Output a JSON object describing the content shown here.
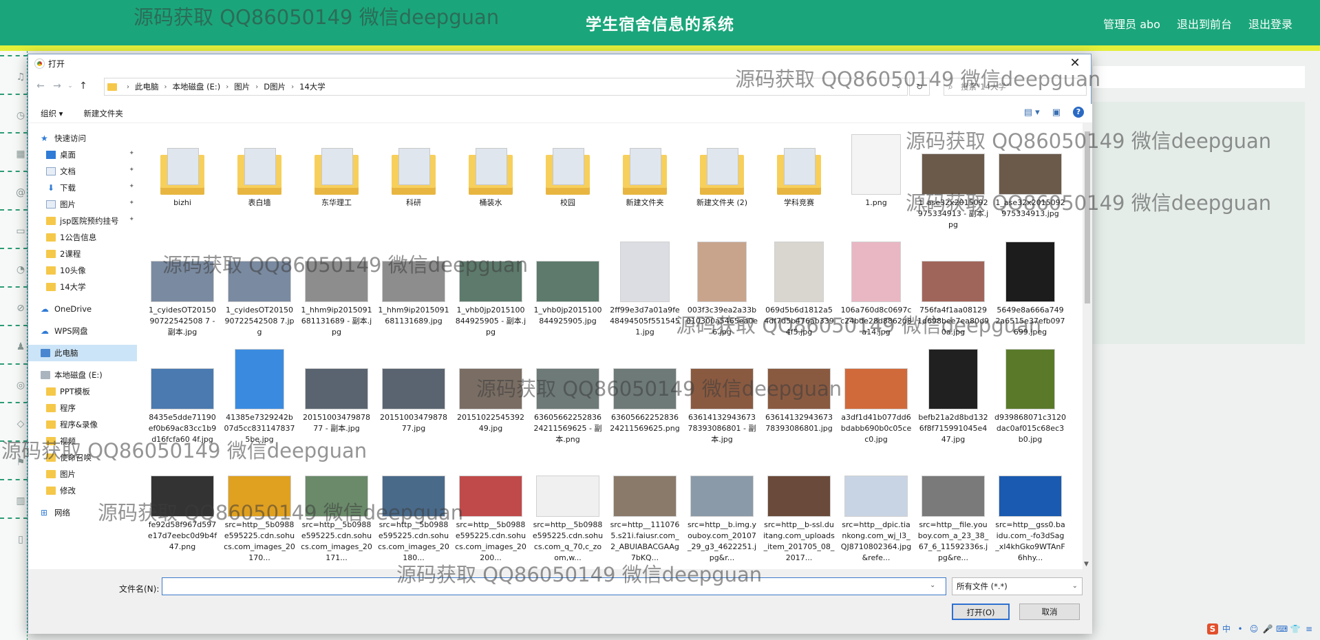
{
  "app": {
    "title": "学生宿舍信息的系统",
    "links": [
      "管理员 abo",
      "退出到前台",
      "退出登录"
    ]
  },
  "watermark_text": "源码获取 QQ86050149 微信deepguan",
  "dialog": {
    "title": "打开",
    "close": "✕",
    "breadcrumbs": [
      "此电脑",
      "本地磁盘 (E:)",
      "图片",
      "D图片",
      "14大学"
    ],
    "search_placeholder": "搜索\"14大学\"",
    "toolbar": {
      "organize": "组织 ▾",
      "new_folder": "新建文件夹"
    },
    "nav": {
      "quick_access": "快速访问",
      "desktop": "桌面",
      "documents": "文档",
      "downloads": "下载",
      "pictures": "图片",
      "folder_jsp": "jsp医院预约挂号",
      "folder_notice": "1公告信息",
      "folder_course": "2课程",
      "folder_avatar": "10头像",
      "folder_univ": "14大学",
      "onedrive": "OneDrive",
      "wps": "WPS网盘",
      "this_pc": "此电脑",
      "local_disk": "本地磁盘 (E:)",
      "ppt": "PPT模板",
      "program": "程序",
      "program_rec": "程序&录像",
      "video": "视频",
      "summon": "使命召唤",
      "pictures2": "图片",
      "edit": "修改",
      "network": "网络"
    },
    "files": [
      {
        "name": "bizhi",
        "kind": "folder"
      },
      {
        "name": "表白墙",
        "kind": "folder"
      },
      {
        "name": "东华理工",
        "kind": "folder"
      },
      {
        "name": "科研",
        "kind": "folder"
      },
      {
        "name": "桶装水",
        "kind": "folder"
      },
      {
        "name": "校园",
        "kind": "folder"
      },
      {
        "name": "新建文件夹",
        "kind": "folder"
      },
      {
        "name": "新建文件夹 (2)",
        "kind": "folder"
      },
      {
        "name": "学科竞赛",
        "kind": "folder"
      },
      {
        "name": "1.png",
        "kind": "tall",
        "color": "#f4f4f4"
      },
      {
        "name": "1_ase32x2015092975334913 - 副本.jpg",
        "kind": "img",
        "color": "#6b5a4a"
      },
      {
        "name": "1_ase32x2015092975334913.jpg",
        "kind": "img",
        "color": "#6b5a4a"
      },
      {
        "name": "1_cyidesOT2015090722542508 7 - 副本.jpg",
        "kind": "img",
        "color": "#7a8aa0"
      },
      {
        "name": "1_cyidesOT2015090722542508 7.jpg",
        "kind": "img",
        "color": "#7a8aa0"
      },
      {
        "name": "1_hhm9ip2015091681131689 - 副本.jpg",
        "kind": "img",
        "color": "#8d8d8d"
      },
      {
        "name": "1_hhm9ip2015091681131689.jpg",
        "kind": "img",
        "color": "#8d8d8d"
      },
      {
        "name": "1_vhb0jp2015100844925905 - 副本.jpg",
        "kind": "img",
        "color": "#5d7a6c"
      },
      {
        "name": "1_vhb0jp2015100844925905.jpg",
        "kind": "img",
        "color": "#5d7a6c"
      },
      {
        "name": "2ff99e3d7a01a9fe48494505f5515451.jpg",
        "kind": "tall",
        "color": "#dcdde2"
      },
      {
        "name": "003f3c39ea2a33b010300a5465ea0e6.jpg",
        "kind": "tall",
        "color": "#c8a48d"
      },
      {
        "name": "069d5b6d1812a54df7d5b476ab3394f5.jpg",
        "kind": "tall",
        "color": "#d8d6cf"
      },
      {
        "name": "106a760d8c0697cc24bde28d8862d8a14.jpg",
        "kind": "tall",
        "color": "#e9b7c3"
      },
      {
        "name": "756fa4f1aa081291d698bee7ea80d90a.jpg",
        "kind": "img",
        "color": "#a0655a"
      },
      {
        "name": "5649e8a666a7492a6515e37efb097699.jpeg",
        "kind": "tall",
        "color": "#1c1c1c"
      },
      {
        "name": "8435e5dde71190ef0b69ac83cc1b9d16fcfa60 4f.jpg",
        "kind": "img",
        "color": "#4a7ab0"
      },
      {
        "name": "41385e7329242b07d5cc8311478375be.jpg",
        "kind": "tall",
        "color": "#3a8be0"
      },
      {
        "name": "2015100347987877 - 副本.jpg",
        "kind": "img",
        "color": "#5a6470"
      },
      {
        "name": "2015100347987877.jpg",
        "kind": "img",
        "color": "#5a6470"
      },
      {
        "name": "2015102254539249.jpg",
        "kind": "img",
        "color": "#7a6e64"
      },
      {
        "name": "6360566225283624211569625 - 副本.png",
        "kind": "img",
        "color": "#6e7a78"
      },
      {
        "name": "6360566225283624211569625.png",
        "kind": "img",
        "color": "#6e7a78"
      },
      {
        "name": "6361413294367378393086801 - 副本.jpg",
        "kind": "img",
        "color": "#8a5a40"
      },
      {
        "name": "6361413294367378393086801.jpg",
        "kind": "img",
        "color": "#8a5a40"
      },
      {
        "name": "a3df1d41b077dd6bdabb690b0c05cec0.jpg",
        "kind": "img",
        "color": "#d06a3a"
      },
      {
        "name": "befb21a2d8bd1326f8f715991045e447.jpg",
        "kind": "tall",
        "color": "#202020"
      },
      {
        "name": "d939868071c3120dac0af015c68ec3b0.jpg",
        "kind": "tall",
        "color": "#5a7a2a"
      },
      {
        "name": "fe92d58f967d597e17d7eebc0d9b4f47.png",
        "kind": "img",
        "color": "#333333"
      },
      {
        "name": "src=http__5b0988e595225.cdn.sohucs.com_images_20170...",
        "kind": "img",
        "color": "#e0a020"
      },
      {
        "name": "src=http__5b0988e595225.cdn.sohucs.com_images_20171...",
        "kind": "img",
        "color": "#6a8a6a"
      },
      {
        "name": "src=http__5b0988e595225.cdn.sohucs.com_images_20180...",
        "kind": "img",
        "color": "#4a6a8a"
      },
      {
        "name": "src=http__5b0988e595225.cdn.sohucs.com_images_20200...",
        "kind": "img",
        "color": "#c04a4a"
      },
      {
        "name": "src=http__5b0988e595225.cdn.sohucs.com_q_70,c_zoom,w...",
        "kind": "img",
        "color": "#f0f0f0"
      },
      {
        "name": "src=http__1110765.s21i.faiusr.com_2_ABUIABACGAAg7bKQ...",
        "kind": "img",
        "color": "#8a7a6a"
      },
      {
        "name": "src=http__b.img.youboy.com_20107_29_g3_4622251.jpg&r...",
        "kind": "img",
        "color": "#8a9aa8"
      },
      {
        "name": "src=http__b-ssl.duitang.com_uploads_item_201705_08_2017...",
        "kind": "img",
        "color": "#6a4a3a"
      },
      {
        "name": "src=http__dpic.tiankong.com_wj_l3_QJ8710802364.jpg&refe...",
        "kind": "img",
        "color": "#c8d4e4"
      },
      {
        "name": "src=http__file.youboy.com_a_23_38_67_6_11592336s.jpg&re...",
        "kind": "img",
        "color": "#7a7a7a"
      },
      {
        "name": "src=http__gss0.baidu.com_-fo3dSag_xI4khGko9WTAnF6hhy...",
        "kind": "img",
        "color": "#1a5ab0"
      }
    ],
    "filename_label": "文件名(N):",
    "filename_value": "",
    "filetype": "所有文件 (*.*)",
    "open_button": "打开(O)",
    "cancel_button": "取消"
  },
  "tray": [
    "S",
    "中",
    "•",
    "☺",
    "🎤",
    "⌨",
    "👕",
    "≡"
  ]
}
